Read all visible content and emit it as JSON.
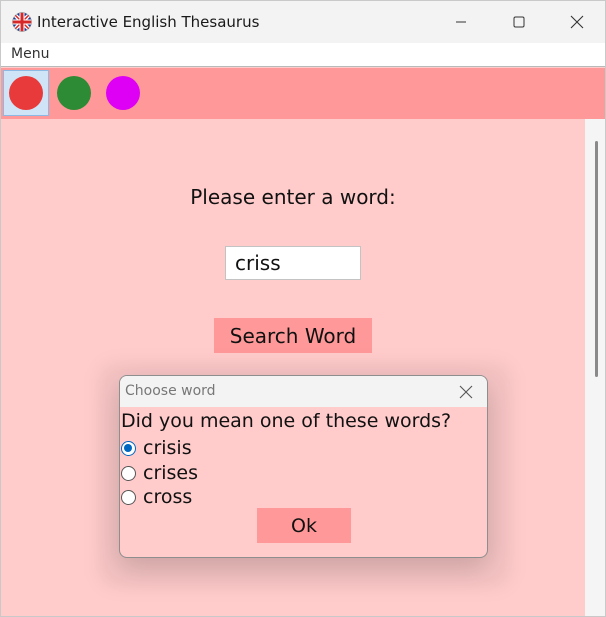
{
  "window": {
    "title": "Interactive English Thesaurus",
    "app_icon": "uk-flag-icon",
    "controls": [
      "minimize-icon",
      "maximize-icon",
      "close-icon"
    ]
  },
  "menubar": {
    "items": [
      {
        "label": "Menu"
      }
    ]
  },
  "toolbar": {
    "color_buttons": [
      {
        "color": "#e83a3a",
        "selected": true
      },
      {
        "color": "#2e8b35",
        "selected": false
      },
      {
        "color": "#dd00f5",
        "selected": false
      }
    ]
  },
  "main": {
    "prompt": "Please enter a word:",
    "word_input": {
      "value": "criss"
    },
    "search_button": "Search Word"
  },
  "dialog": {
    "title": "Choose word",
    "question": "Did you mean one of these words?",
    "options": [
      {
        "label": "crisis",
        "checked": true
      },
      {
        "label": "crises",
        "checked": false
      },
      {
        "label": "cross",
        "checked": false
      }
    ],
    "ok_button": "Ok"
  },
  "colors": {
    "background": "#ffcbcb",
    "accent": "#ff9999",
    "radio_selected": "#0067c0"
  }
}
